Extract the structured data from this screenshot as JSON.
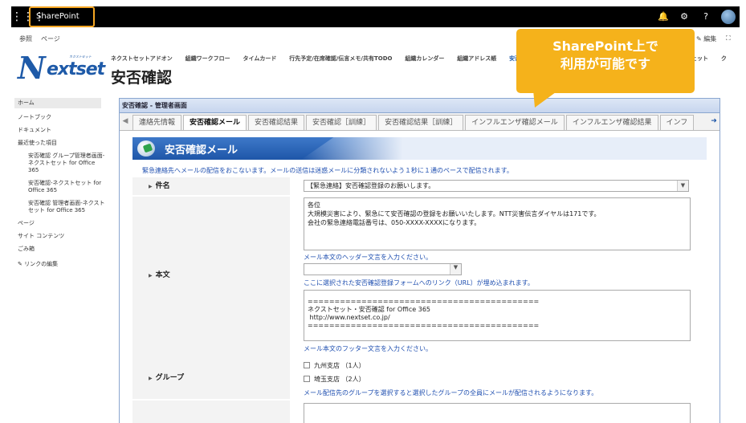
{
  "suitebar": {
    "app_name": "SharePoint",
    "bell_icon": "🔔",
    "gear_icon": "⚙",
    "help_icon": "?"
  },
  "ribbon": {
    "browse": "参照",
    "page": "ページ",
    "edit": "✎ 編集",
    "focus_icon": "⛶"
  },
  "logo": {
    "letter": "N",
    "text": "extset",
    "tiny": "ネクストセット"
  },
  "topnav": [
    "ネクストセットアドオン",
    "組織ワークフロー",
    "タイムカード",
    "行先予定/在席確認/伝言メモ/共有TODO",
    "組織カレンダー",
    "組織アドレス帳",
    "安否",
    "",
    "",
    "",
    "",
    "",
    "",
    "ジェット",
    "ク"
  ],
  "page_title": "安否確認",
  "callout": {
    "line1": "SharePoint上で",
    "line2": "利用が可能です"
  },
  "leftnav": {
    "home": "ホーム",
    "notebook": "ノートブック",
    "documents": "ドキュメント",
    "recent": "最近使った項目",
    "recent_items": [
      "安否確認 グループ管理者画面-ネクストセット for Office 365",
      "安否確認-ネクストセット for Office 365",
      "安否確認 管理者画面-ネクストセット for Office 365"
    ],
    "pages": "ページ",
    "site_contents": "サイト コンテンツ",
    "recycle": "ごみ箱",
    "edit_links": "リンクの編集"
  },
  "panel": {
    "header": "安否確認 - 管理者画面",
    "tabs": [
      "連絡先情報",
      "安否確認メール",
      "安否確認結果",
      "安否確認［訓練］",
      "安否確認結果［訓練］",
      "インフルエンザ確認メール",
      "インフルエンザ確認結果",
      "インフ"
    ],
    "active_tab": 1,
    "section_title": "安否確認メール",
    "description": "緊急連絡先へメールの配信をおこないます。メールの送信は迷惑メールに分類されないよう１秒に１通のペースで配信されます。"
  },
  "form": {
    "subject_label": "件名",
    "subject_value": "【緊急連絡】安否確認登録のお願いします。",
    "body_label": "本文",
    "header_text_lines": [
      "各位",
      "",
      "大規模災害により、緊急にて安否確認の登録をお願いいたします。NTT災害伝言ダイヤルは171です。",
      "会社の緊急連絡電話番号は、050-XXXX-XXXXになります。"
    ],
    "header_note": "メール本文のヘッダー文言を入力ください。",
    "link_select_value": "",
    "link_note": "ここに選択された安否確認登録フォームへのリンク（URL）が埋め込まれます。",
    "footer_text_lines": [
      "===========================================",
      "ネクストセット・安否確認 for Office 365",
      " http://www.nextset.co.jp/",
      "==========================================="
    ],
    "footer_note": "メール本文のフッター文言を入力ください。",
    "group_label": "グループ",
    "groups": [
      "九州支店 （1人）",
      "埼玉支店 （2人）"
    ],
    "group_note": "メール配信先のグループを選択すると選択したグループの全員にメールが配信されるようになります。"
  }
}
